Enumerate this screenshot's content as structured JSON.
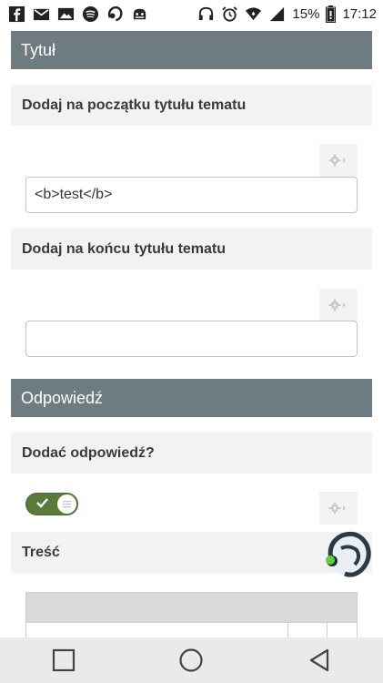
{
  "status_bar": {
    "battery_percent": "15%",
    "time": "17:12",
    "left_icons": [
      "facebook-icon",
      "gmail-icon",
      "gallery-icon",
      "spotify-icon",
      "teamspeak-icon",
      "game-icon"
    ],
    "right_icons": [
      "headphones-icon",
      "alarm-icon",
      "wifi-icon",
      "signal-icon",
      "battery-icon"
    ]
  },
  "sections": {
    "title_section": "Tytuł",
    "reply_section": "Odpowiedź"
  },
  "fields": {
    "prefix_label": "Dodaj na początku tytułu tematu",
    "prefix_value": "<b>test</b>",
    "suffix_label": "Dodaj na końcu tytułu tematu",
    "suffix_value": "",
    "add_reply_label": "Dodać odpowiedź?",
    "add_reply_enabled": true,
    "content_label": "Treść"
  },
  "colors": {
    "section_header_bg": "#6e7b80",
    "label_bar_bg": "#f2f2f2",
    "toggle_on": "#5a7a3a"
  },
  "navigation": [
    "recent-apps-button",
    "home-button",
    "back-button"
  ]
}
